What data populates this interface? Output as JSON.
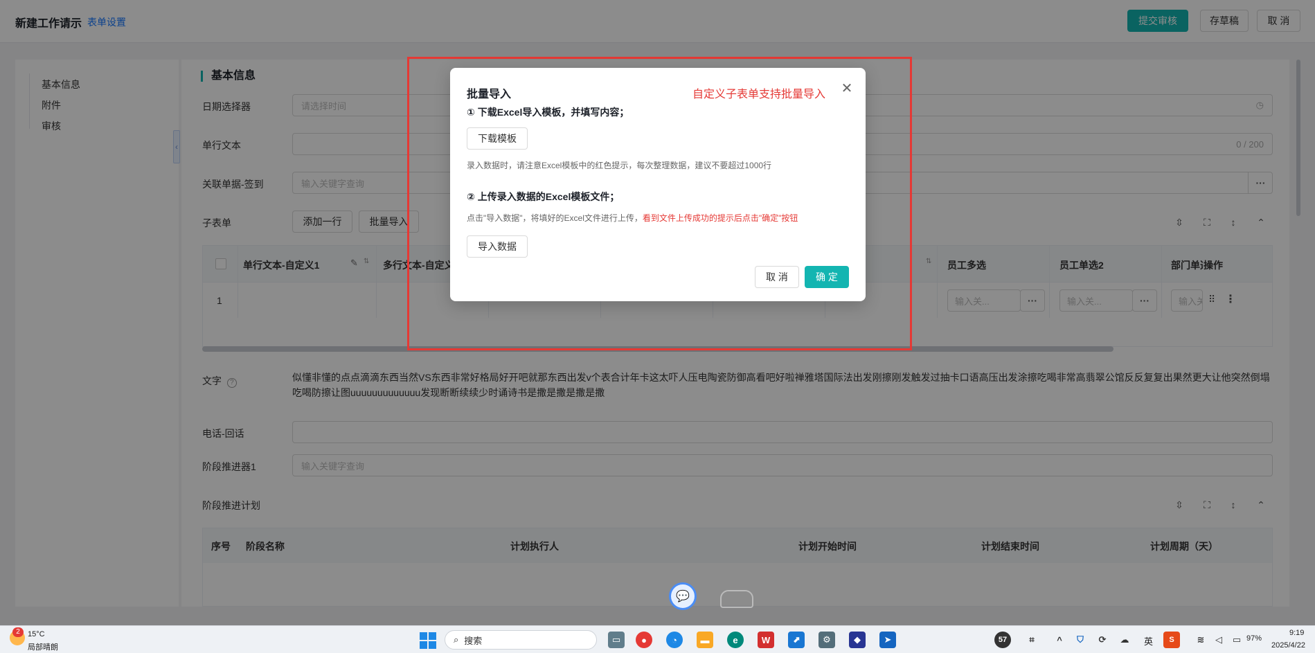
{
  "header": {
    "title": "新建工作请示",
    "form_settings": "表单设置",
    "submit": "提交审核",
    "draft": "存草稿",
    "cancel": "取 消"
  },
  "sidebar": {
    "items": [
      {
        "label": "基本信息"
      },
      {
        "label": "附件"
      },
      {
        "label": "审核"
      }
    ]
  },
  "form": {
    "section_title": "基本信息",
    "date_picker": {
      "label": "日期选择器",
      "placeholder": "请选择时间"
    },
    "single_text": {
      "label": "单行文本",
      "counter": "0 / 200"
    },
    "related_doc": {
      "label": "关联单据-签到",
      "placeholder": "输入关键字查询"
    },
    "subform": {
      "label": "子表单",
      "add_row": "添加一行",
      "batch_import": "批量导入",
      "columns": [
        "单行文本-自定义1",
        "多行文本-自定义",
        "员工多选",
        "员工单选2",
        "部门单选",
        "操作"
      ],
      "row_index": "1",
      "input_placeholder": "输入关..."
    },
    "text_field": {
      "label": "文字",
      "value": "似懂非懂的点点滴滴东西当然VS东西非常好格局好开吧就那东西出发v个表合计年卡这太吓人压电陶瓷防御高看吧好啦禅雅塔国际法出发刚擦刚发触发过抽卡口语高压出发涂擦吃喝非常高翡翠公馆反反复复出果然更大让他突然倒塌吃喝防擦让图uuuuuuuuuuuuu发现断断续续少时诵诗书是撒是撒是撒是撒"
    },
    "phone": {
      "label": "电话-回话"
    },
    "stage_pusher": {
      "label": "阶段推进器1",
      "placeholder": "输入关键字查询"
    },
    "stage_plan": {
      "label": "阶段推进计划",
      "columns": [
        "序号",
        "阶段名称",
        "计划执行人",
        "计划开始时间",
        "计划结束时间",
        "计划周期（天）"
      ]
    }
  },
  "modal": {
    "title": "批量导入",
    "annotation": "自定义子表单支持批量导入",
    "step1": "① 下载Excel导入模板，并填写内容；",
    "download_button": "下载模板",
    "tip1": "录入数据时，请注意Excel模板中的红色提示，每次整理数据，建议不要超过1000行",
    "step2": "② 上传录入数据的Excel模板文件；",
    "tip2_prefix": "点击\"导入数据\"，将填好的Excel文件进行上传，",
    "tip2_red": "看到文件上传成功的提示后点击\"确定\"按钮",
    "import_button": "导入数据",
    "cancel": "取 消",
    "ok": "确 定"
  },
  "taskbar": {
    "weather_badge": "2",
    "temperature": "15°C",
    "weather": "局部晴朗",
    "search": "搜索",
    "notification_count": "57",
    "ime": "英",
    "battery": "97%",
    "time": "9:19",
    "date": "2025/4/22"
  },
  "colors": {
    "primary": "#13b5b1",
    "link": "#1677ff",
    "annotation_red": "#e53935"
  }
}
